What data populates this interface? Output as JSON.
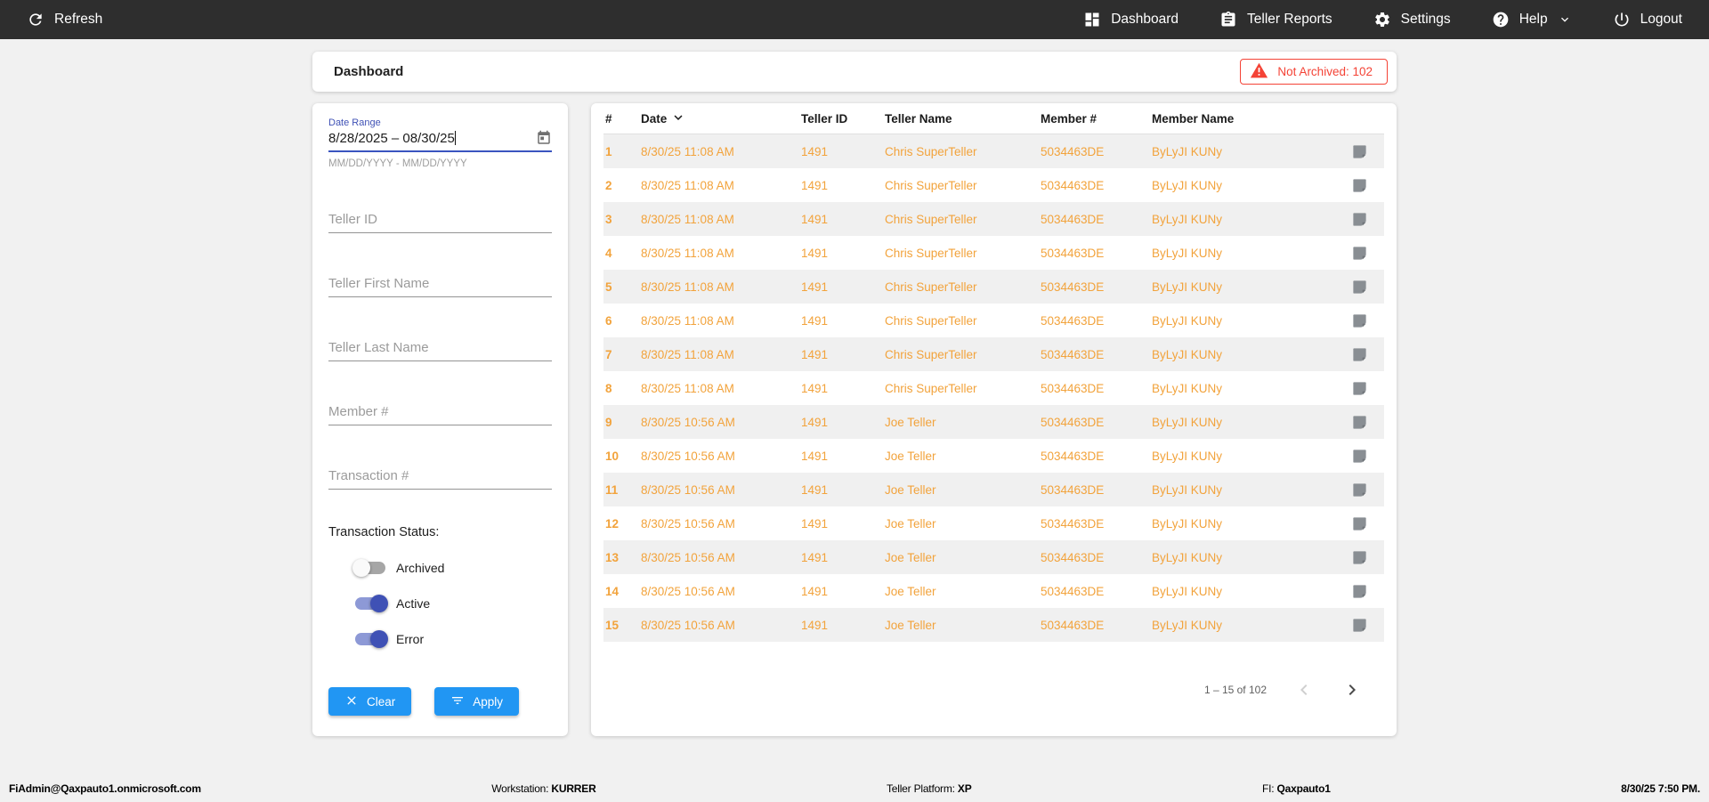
{
  "navbar": {
    "refresh": "Refresh",
    "dashboard": "Dashboard",
    "teller_reports": "Teller Reports",
    "settings": "Settings",
    "help": "Help",
    "logout": "Logout"
  },
  "header": {
    "title": "Dashboard",
    "not_archived_label": "Not Archived: 102"
  },
  "filters": {
    "date_range": {
      "label": "Date Range",
      "value": "8/28/2025 – 08/30/25",
      "hint": "MM/DD/YYYY - MM/DD/YYYY"
    },
    "fields": [
      {
        "label": "Teller ID"
      },
      {
        "label": "Teller First Name"
      },
      {
        "label": "Teller Last Name"
      },
      {
        "label": "Member #"
      },
      {
        "label": "Transaction #"
      }
    ],
    "status": {
      "label": "Transaction Status:",
      "toggles": [
        {
          "label": "Archived",
          "on": false
        },
        {
          "label": "Active",
          "on": true
        },
        {
          "label": "Error",
          "on": true
        }
      ]
    },
    "clear_label": "Clear",
    "apply_label": "Apply"
  },
  "table": {
    "columns": [
      "#",
      "Date",
      "Teller ID",
      "Teller Name",
      "Member #",
      "Member Name"
    ],
    "rows": [
      {
        "num": "1",
        "date": "8/30/25 11:08 AM",
        "teller_id": "1491",
        "teller_name": "Chris SuperTeller",
        "member_num": "5034463DE",
        "member_name": "ByLyJI KUNy"
      },
      {
        "num": "2",
        "date": "8/30/25 11:08 AM",
        "teller_id": "1491",
        "teller_name": "Chris SuperTeller",
        "member_num": "5034463DE",
        "member_name": "ByLyJI KUNy"
      },
      {
        "num": "3",
        "date": "8/30/25 11:08 AM",
        "teller_id": "1491",
        "teller_name": "Chris SuperTeller",
        "member_num": "5034463DE",
        "member_name": "ByLyJI KUNy"
      },
      {
        "num": "4",
        "date": "8/30/25 11:08 AM",
        "teller_id": "1491",
        "teller_name": "Chris SuperTeller",
        "member_num": "5034463DE",
        "member_name": "ByLyJI KUNy"
      },
      {
        "num": "5",
        "date": "8/30/25 11:08 AM",
        "teller_id": "1491",
        "teller_name": "Chris SuperTeller",
        "member_num": "5034463DE",
        "member_name": "ByLyJI KUNy"
      },
      {
        "num": "6",
        "date": "8/30/25 11:08 AM",
        "teller_id": "1491",
        "teller_name": "Chris SuperTeller",
        "member_num": "5034463DE",
        "member_name": "ByLyJI KUNy"
      },
      {
        "num": "7",
        "date": "8/30/25 11:08 AM",
        "teller_id": "1491",
        "teller_name": "Chris SuperTeller",
        "member_num": "5034463DE",
        "member_name": "ByLyJI KUNy"
      },
      {
        "num": "8",
        "date": "8/30/25 11:08 AM",
        "teller_id": "1491",
        "teller_name": "Chris SuperTeller",
        "member_num": "5034463DE",
        "member_name": "ByLyJI KUNy"
      },
      {
        "num": "9",
        "date": "8/30/25 10:56 AM",
        "teller_id": "1491",
        "teller_name": "Joe Teller",
        "member_num": "5034463DE",
        "member_name": "ByLyJI KUNy"
      },
      {
        "num": "10",
        "date": "8/30/25 10:56 AM",
        "teller_id": "1491",
        "teller_name": "Joe Teller",
        "member_num": "5034463DE",
        "member_name": "ByLyJI KUNy"
      },
      {
        "num": "11",
        "date": "8/30/25 10:56 AM",
        "teller_id": "1491",
        "teller_name": "Joe Teller",
        "member_num": "5034463DE",
        "member_name": "ByLyJI KUNy"
      },
      {
        "num": "12",
        "date": "8/30/25 10:56 AM",
        "teller_id": "1491",
        "teller_name": "Joe Teller",
        "member_num": "5034463DE",
        "member_name": "ByLyJI KUNy"
      },
      {
        "num": "13",
        "date": "8/30/25 10:56 AM",
        "teller_id": "1491",
        "teller_name": "Joe Teller",
        "member_num": "5034463DE",
        "member_name": "ByLyJI KUNy"
      },
      {
        "num": "14",
        "date": "8/30/25 10:56 AM",
        "teller_id": "1491",
        "teller_name": "Joe Teller",
        "member_num": "5034463DE",
        "member_name": "ByLyJI KUNy"
      },
      {
        "num": "15",
        "date": "8/30/25 10:56 AM",
        "teller_id": "1491",
        "teller_name": "Joe Teller",
        "member_num": "5034463DE",
        "member_name": "ByLyJI KUNy"
      }
    ],
    "pagination": {
      "range_label": "1 – 15 of 102"
    }
  },
  "footer": {
    "user": "FiAdmin@Qaxpauto1.onmicrosoft.com",
    "workstation_label": "Workstation: ",
    "workstation": "KURRER",
    "platform_label": "Teller Platform: ",
    "platform": "XP",
    "fi_label": "FI: ",
    "fi": "Qaxpauto1",
    "datetime": "8/30/25 7:50 PM."
  },
  "colors": {
    "navbar": "#2e2e2e",
    "accent_blue": "#2196f3",
    "primary_indigo": "#3f51b5",
    "row_orange": "#f2a33c",
    "alert_red": "#f44336"
  }
}
